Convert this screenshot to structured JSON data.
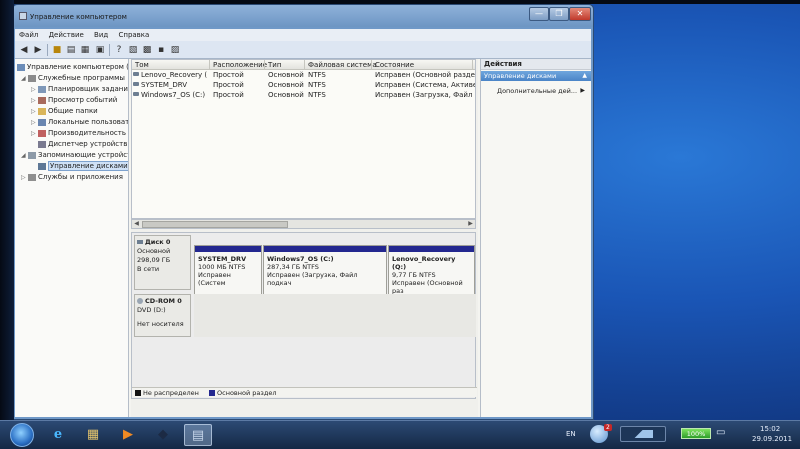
{
  "window": {
    "title": "Управление компьютером",
    "controls": {
      "minimize": "—",
      "maximize": "❐",
      "close": "✕"
    }
  },
  "menu": [
    "Файл",
    "Действие",
    "Вид",
    "Справка"
  ],
  "tree": {
    "items": [
      {
        "label": "Управление компьютером (л",
        "level": 0,
        "expander": "",
        "icon": "computer-icon"
      },
      {
        "label": "Служебные программы",
        "level": 1,
        "expander": "◢",
        "icon": "tools-icon"
      },
      {
        "label": "Планировщик заданий",
        "level": 2,
        "expander": "▷",
        "icon": "clock-icon"
      },
      {
        "label": "Просмотр событий",
        "level": 2,
        "expander": "▷",
        "icon": "event-icon"
      },
      {
        "label": "Общие папки",
        "level": 2,
        "expander": "▷",
        "icon": "folder-icon"
      },
      {
        "label": "Локальные пользовате",
        "level": 2,
        "expander": "▷",
        "icon": "users-icon"
      },
      {
        "label": "Производительность",
        "level": 2,
        "expander": "▷",
        "icon": "performance-icon"
      },
      {
        "label": "Диспетчер устройств",
        "level": 2,
        "expander": "",
        "icon": "device-icon"
      },
      {
        "label": "Запоминающие устройст",
        "level": 1,
        "expander": "◢",
        "icon": "storage-icon"
      },
      {
        "label": "Управление дисками",
        "level": 2,
        "expander": "",
        "icon": "disk-icon",
        "selected": true
      },
      {
        "label": "Службы и приложения",
        "level": 1,
        "expander": "▷",
        "icon": "services-icon"
      }
    ]
  },
  "volumes": {
    "columns": [
      "Том",
      "Расположение",
      "Тип",
      "Файловая система",
      "Состояние"
    ],
    "rows": [
      [
        "Lenovo_Recovery (Q:)",
        "Простой",
        "Основной",
        "NTFS",
        "Исправен (Основной раздел)"
      ],
      [
        "SYSTEM_DRV",
        "Простой",
        "Основной",
        "NTFS",
        "Исправен (Система, Активен, О"
      ],
      [
        "Windows7_OS (C:)",
        "Простой",
        "Основной",
        "NTFS",
        "Исправен (Загрузка, Файл подк"
      ]
    ]
  },
  "disks": {
    "disk0": {
      "name": "Диск 0",
      "type": "Основной",
      "size": "298,09 ГБ",
      "status": "В сети",
      "partitions": [
        {
          "name": "SYSTEM_DRV",
          "size": "1000 МБ NTFS",
          "status": "Исправен (Систем"
        },
        {
          "name": "Windows7_OS  (C:)",
          "size": "287,34 ГБ NTFS",
          "status": "Исправен (Загрузка, Файл подкач"
        },
        {
          "name": "Lenovo_Recovery  (Q:)",
          "size": "9,77 ГБ NTFS",
          "status": "Исправен (Основной раз"
        }
      ]
    },
    "cdrom": {
      "name": "CD-ROM 0",
      "type": "DVD (D:)",
      "status": "Нет носителя"
    }
  },
  "legend": {
    "unallocated": "Не распределен",
    "primary": "Основной раздел",
    "unallocated_color": "#111111",
    "primary_color": "#23278f"
  },
  "actions": {
    "title": "Действия",
    "section": "Управление дисками",
    "more": "Дополнительные дей..."
  },
  "taskbar": {
    "lang": "EN",
    "battery": "100%",
    "time": "15:02",
    "date": "29.09.2011",
    "notification_badge": "2"
  },
  "colors": {
    "partition_bar": "#23278f",
    "selection": "#cfe1f6",
    "action_header": "#4a84c7"
  }
}
